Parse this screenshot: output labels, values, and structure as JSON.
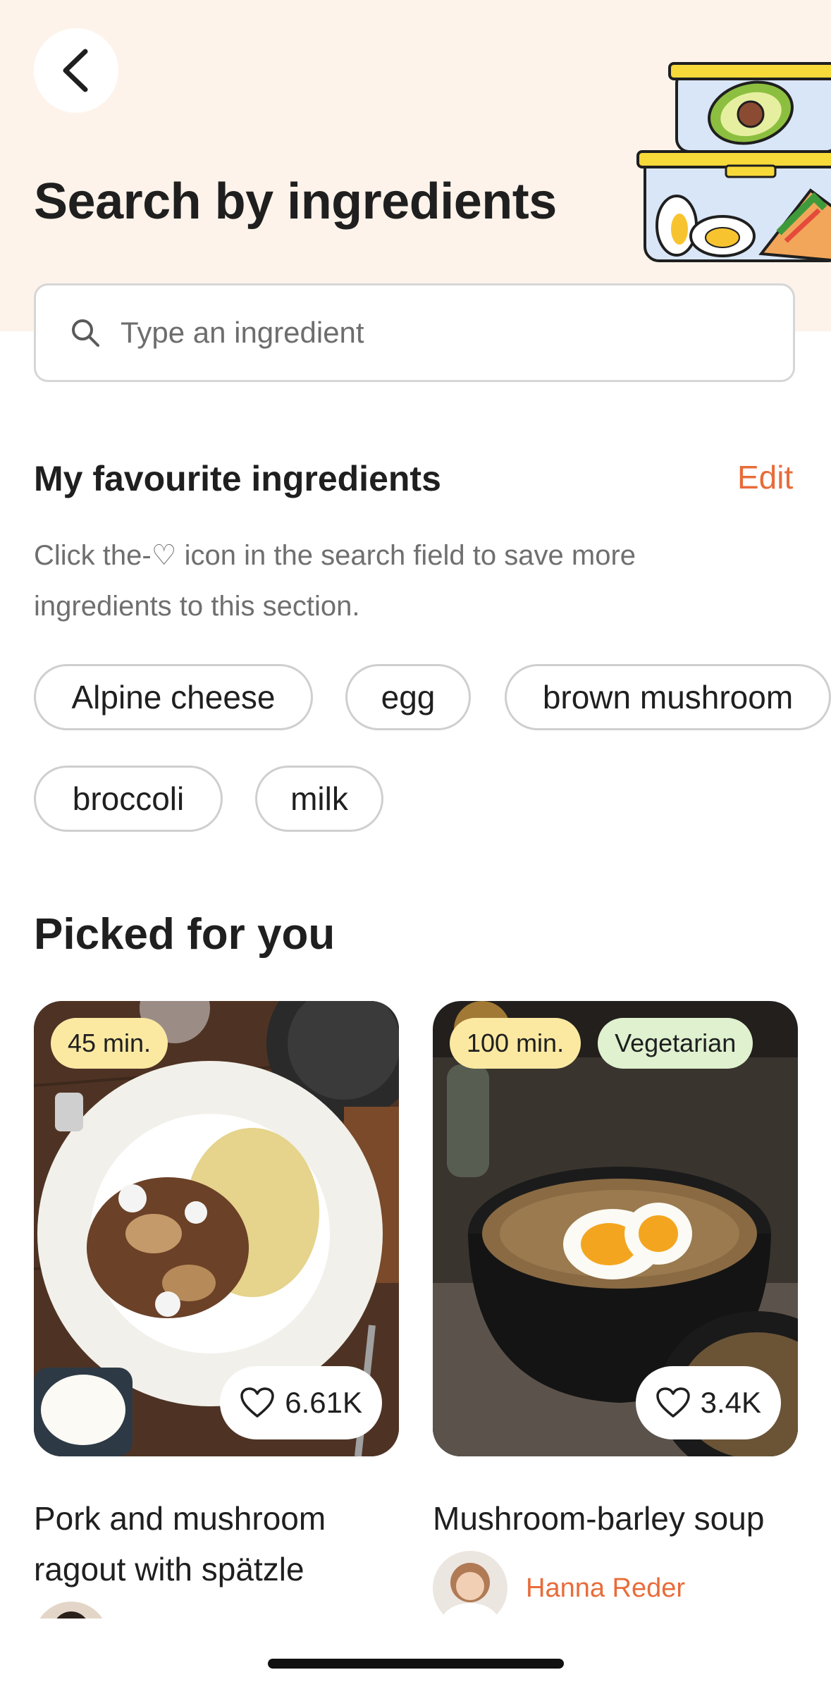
{
  "header": {
    "title": "Search by ingredients",
    "back_icon": "chevron-left-icon"
  },
  "search": {
    "placeholder": "Type an ingredient",
    "value": ""
  },
  "favourites": {
    "title": "My favourite ingredients",
    "edit_label": "Edit",
    "description": "Click the-♡ icon in the search field to save more ingredients to this section.",
    "chips": [
      "Alpine cheese",
      "egg",
      "brown mushroom",
      "broccoli",
      "milk"
    ]
  },
  "picked": {
    "title": "Picked for you",
    "cards": [
      {
        "time": "45 min.",
        "tag": "",
        "likes": "6.61K",
        "title": "Pork and mushroom ragout with spätzle",
        "author": ""
      },
      {
        "time": "100 min.",
        "tag": "Vegetarian",
        "likes": "3.4K",
        "title": "Mushroom-barley soup",
        "author": "Hanna Reder"
      }
    ]
  },
  "colors": {
    "accent": "#e86c3a",
    "header_bg": "#fdf3ea",
    "time_badge": "#fbe9a2",
    "veg_badge": "#dff1cf"
  }
}
